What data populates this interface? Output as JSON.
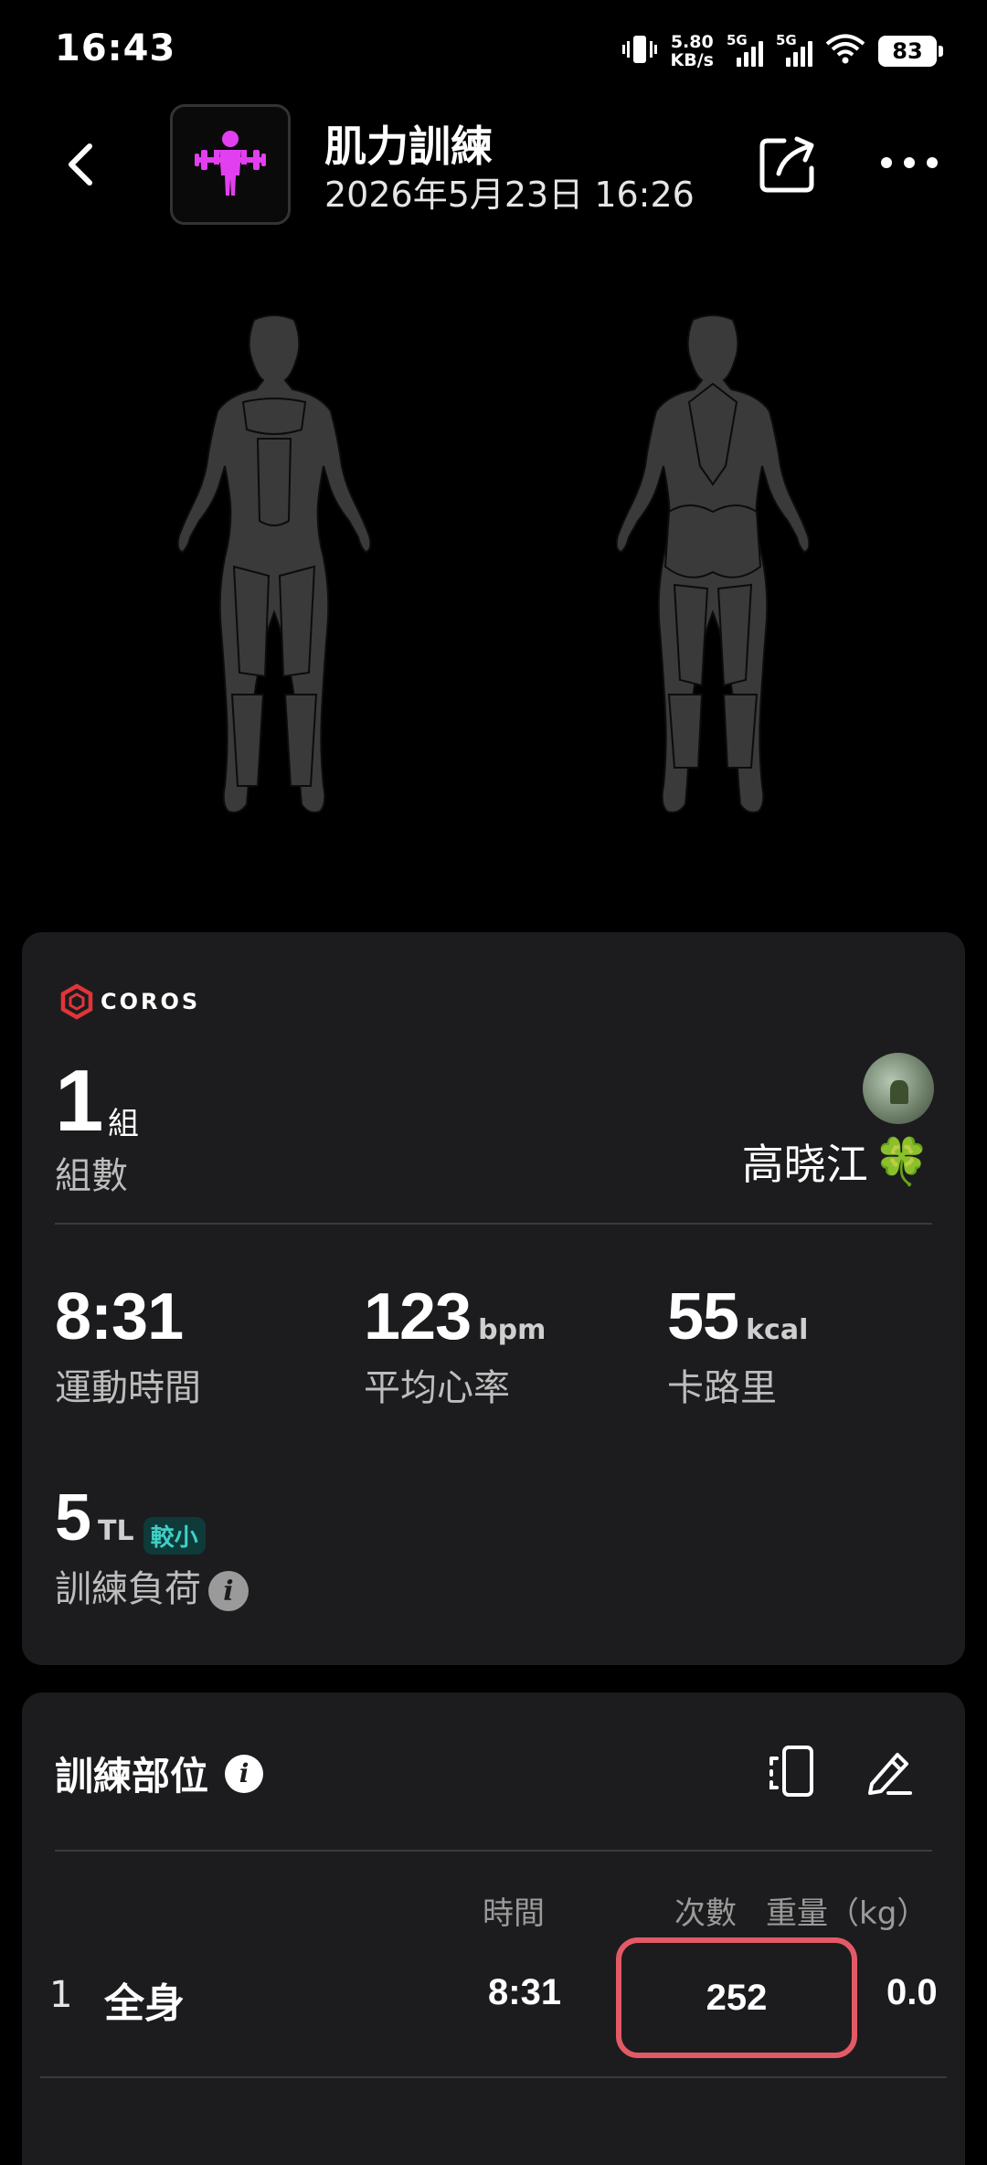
{
  "status_bar": {
    "time": "16:43",
    "net_speed_value": "5.80",
    "net_speed_unit": "KB/s",
    "signal1_label": "5G",
    "signal2_label": "5G",
    "battery": "83"
  },
  "header": {
    "title": "肌力訓練",
    "date": "2026年5月23日 16:26",
    "accent_color": "#e23ff0"
  },
  "summary": {
    "brand": "COROS",
    "brand_color": "#e0353a",
    "sets_value": "1",
    "sets_unit": "組",
    "sets_label": "組數",
    "user_name": "高晓江",
    "user_emoji": "🍀",
    "stats": [
      {
        "value": "8:31",
        "unit": "",
        "label": "運動時間"
      },
      {
        "value": "123",
        "unit": "bpm",
        "label": "平均心率"
      },
      {
        "value": "55",
        "unit": "kcal",
        "label": "卡路里"
      }
    ],
    "load": {
      "value": "5",
      "unit": "TL",
      "badge": "較小",
      "label": "訓練負荷"
    }
  },
  "training_parts": {
    "title": "訓練部位",
    "columns": {
      "time": "時間",
      "reps": "次數",
      "weight": "重量（kg）"
    },
    "rows": [
      {
        "index": "1",
        "part": "全身",
        "time": "8:31",
        "reps": "252",
        "weight": "0.0"
      }
    ],
    "highlight_color": "#e35a66"
  }
}
